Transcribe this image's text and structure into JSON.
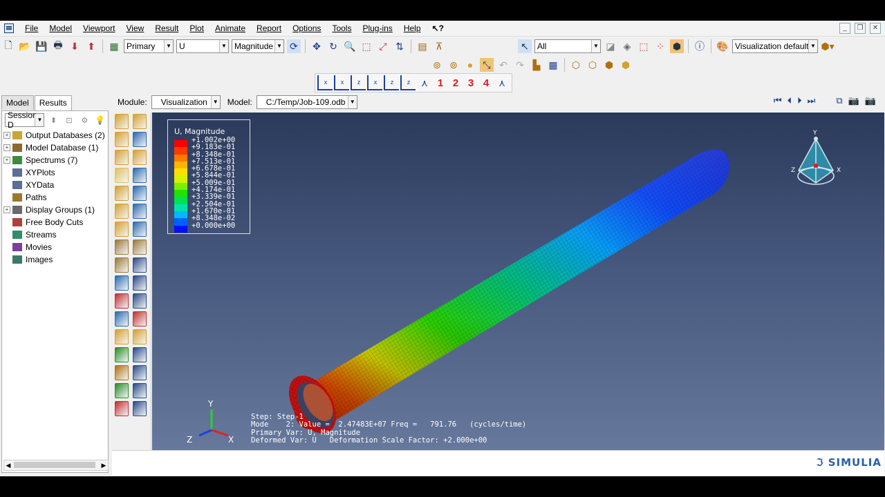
{
  "menu": [
    "File",
    "Model",
    "Viewport",
    "View",
    "Result",
    "Plot",
    "Animate",
    "Report",
    "Options",
    "Tools",
    "Plug-ins",
    "Help"
  ],
  "help_pointer": "?",
  "toolbar": {
    "primary_combo": "Primary",
    "variable_combo": "U",
    "component_combo": "Magnitude",
    "selection_filter": "All",
    "visualization_defaults": "Visualization defaults",
    "view_numbers": [
      "1",
      "2",
      "3",
      "4"
    ]
  },
  "tabs": [
    "Model",
    "Results"
  ],
  "session_combo": "Session D",
  "tree": [
    {
      "label": "Output Databases (2)",
      "expand": true,
      "icon": "#c9a635"
    },
    {
      "label": "Model Database (1)",
      "expand": true,
      "icon": "#8d6a2d"
    },
    {
      "label": "Spectrums (7)",
      "expand": true,
      "icon": "#3f8a3f"
    },
    {
      "label": "XYPlots",
      "expand": false,
      "icon": "#5a6f96"
    },
    {
      "label": "XYData",
      "expand": false,
      "icon": "#5a6f96"
    },
    {
      "label": "Paths",
      "expand": false,
      "icon": "#9a7a2d"
    },
    {
      "label": "Display Groups (1)",
      "expand": true,
      "icon": "#6a6a6a"
    },
    {
      "label": "Free Body Cuts",
      "expand": false,
      "icon": "#b0403a"
    },
    {
      "label": "Streams",
      "expand": false,
      "icon": "#2f8f6a"
    },
    {
      "label": "Movies",
      "expand": false,
      "icon": "#7a3f9a"
    },
    {
      "label": "Images",
      "expand": false,
      "icon": "#3a7a6a"
    }
  ],
  "module_bar": {
    "module_label": "Module:",
    "module_value": "Visualization",
    "model_label": "Model:",
    "model_value": "C:/Temp/Job-109.odb"
  },
  "legend": {
    "title": "U, Magnitude",
    "values": [
      "+1.002e+00",
      "+9.183e-01",
      "+8.348e-01",
      "+7.513e-01",
      "+6.678e-01",
      "+5.844e-01",
      "+5.009e-01",
      "+4.174e-01",
      "+3.339e-01",
      "+2.504e-01",
      "+1.670e-01",
      "+8.348e-02",
      "+0.000e+00"
    ],
    "colors": [
      "#ff0000",
      "#ff3a00",
      "#ff7a00",
      "#ffb400",
      "#ffe000",
      "#d8f000",
      "#7cf000",
      "#22e000",
      "#00e050",
      "#00e0b0",
      "#00b8ff",
      "#0060ff",
      "#0010ff"
    ]
  },
  "step_info": {
    "line1": "Step: Step-1",
    "line2": "Mode    2: Value =  2.47483E+07 Freq =   791.76   (cycles/time)",
    "line3": "Primary Var: U, Magnitude",
    "line4": "Deformed Var: U   Deformation Scale Factor: +2.000e+00"
  },
  "triad": {
    "x": "X",
    "y": "Y",
    "z": "Z"
  },
  "viewcube": {
    "x": "X",
    "y": "Y",
    "z": "Z"
  },
  "brand": "SIMULIA"
}
